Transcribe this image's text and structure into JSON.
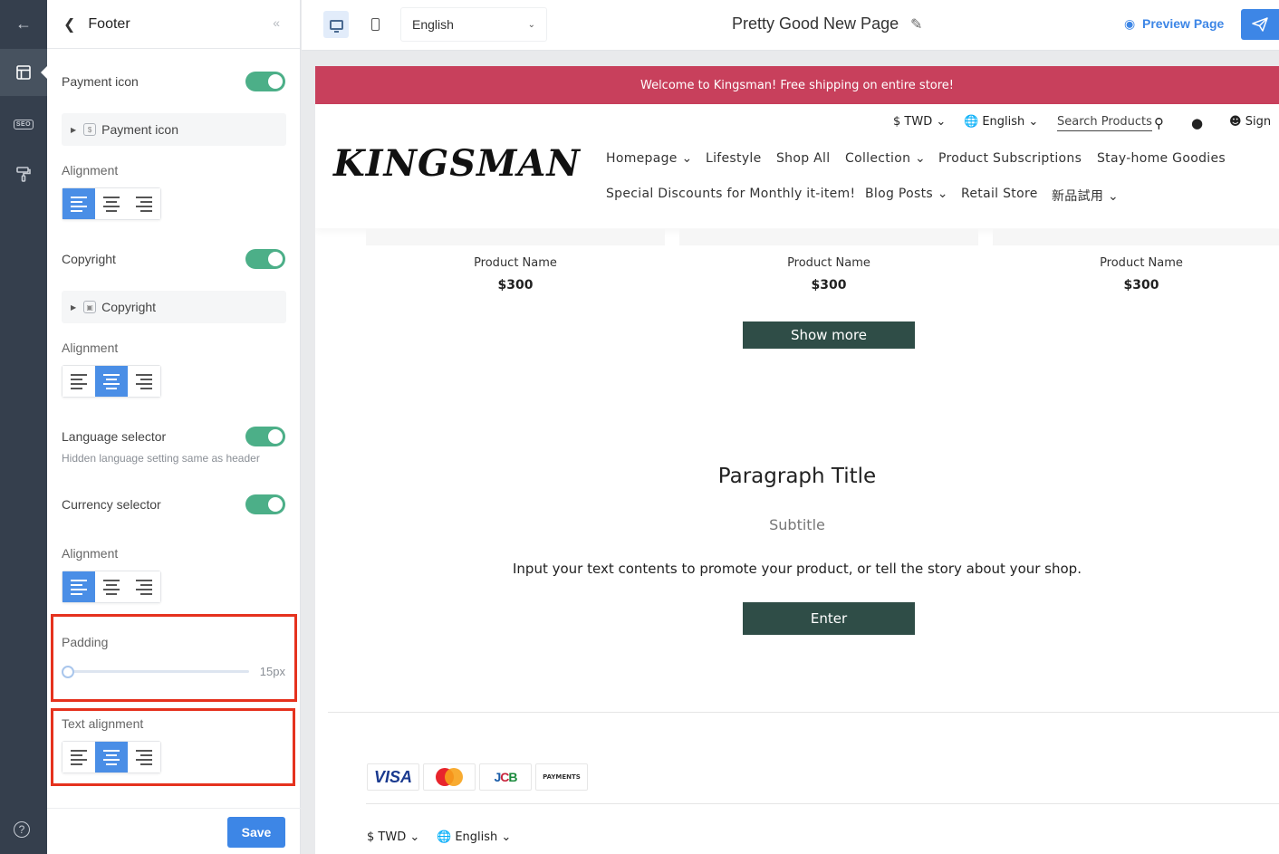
{
  "rail": {
    "back_icon": "arrow-left-icon",
    "layout_icon": "layout-icon",
    "seo_label": "SEO",
    "paint_icon": "paint-roller-icon",
    "help_label": "?"
  },
  "panel": {
    "title": "Footer",
    "back_icon": "chevron-left-icon",
    "collapse_glyph": "«",
    "payment_icon": {
      "label": "Payment icon",
      "enabled": true,
      "item_label": "Payment icon",
      "alignment_label": "Alignment",
      "alignment": "left"
    },
    "copyright": {
      "label": "Copyright",
      "enabled": true,
      "item_label": "Copyright",
      "alignment_label": "Alignment",
      "alignment": "center"
    },
    "language_selector": {
      "label": "Language selector",
      "enabled": true,
      "hint": "Hidden language setting same as header"
    },
    "currency_selector": {
      "label": "Currency selector",
      "enabled": true,
      "alignment_label": "Alignment",
      "alignment": "left"
    },
    "padding": {
      "label": "Padding",
      "value": "15px",
      "fraction": 0.0
    },
    "text_alignment": {
      "label": "Text alignment",
      "alignment": "center"
    },
    "save_label": "Save",
    "highlight_color": "#e5321e",
    "toggle_color": "#4caf88",
    "accent": "#3d86e6"
  },
  "toolbar": {
    "language": "English",
    "page_title": "Pretty Good New Page",
    "preview_label": "Preview Page"
  },
  "site": {
    "announcement": "Welcome to Kingsman! Free shipping on entire store!",
    "announcement_color": "#c8405c",
    "currency": "$ TWD",
    "language": "English",
    "search_label": "Search Products",
    "sign_label": "Sign",
    "logo": "KINGSMAN",
    "nav": {
      "homepage": "Homepage",
      "lifestyle": "Lifestyle",
      "shop_all": "Shop All",
      "collection": "Collection",
      "subscriptions": "Product Subscriptions",
      "stay_home": "Stay-home Goodies",
      "discounts": "Special Discounts for Monthly it-item!",
      "blog": "Blog Posts",
      "retail": "Retail Store",
      "trial": "新品試用"
    },
    "products": [
      {
        "name": "Product Name",
        "price": "$300"
      },
      {
        "name": "Product Name",
        "price": "$300"
      },
      {
        "name": "Product Name",
        "price": "$300"
      }
    ],
    "show_more": "Show more",
    "paragraph": {
      "title": "Paragraph Title",
      "subtitle": "Subtitle",
      "text": "Input your text contents to promote your product, or tell the story about your shop.",
      "button": "Enter"
    },
    "payments": {
      "visa": "VISA",
      "jcb": "JCB",
      "generic": "PAYMENTS"
    },
    "footer_currency": "$ TWD",
    "footer_language": "English",
    "button_color": "#2f4d47"
  }
}
